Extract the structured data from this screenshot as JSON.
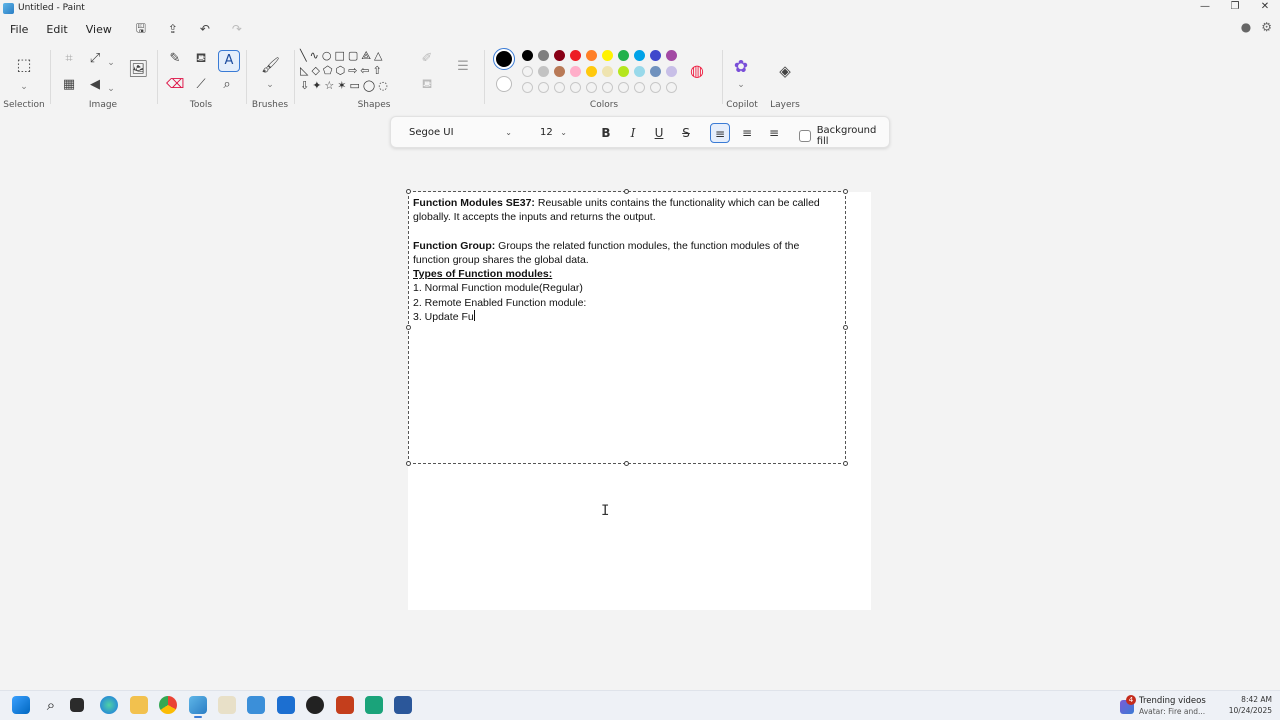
{
  "window": {
    "title": "Untitled - Paint",
    "minimize": "—",
    "maximize": "❐",
    "close": "✕"
  },
  "menu": {
    "file": "File",
    "edit": "Edit",
    "view": "View"
  },
  "ribbon": {
    "groups": {
      "selection": "Selection",
      "image": "Image",
      "tools": "Tools",
      "brushes": "Brushes",
      "shapes": "Shapes",
      "colors": "Colors",
      "copilot": "Copilot",
      "layers": "Layers"
    },
    "current_colors": {
      "primary": "#000000",
      "secondary": "#ffffff"
    },
    "palette_row1": [
      "#000000",
      "#7f7f7f",
      "#880015",
      "#ed1c24",
      "#ff7f27",
      "#fff200",
      "#22b14c",
      "#00a2e8",
      "#3f48cc",
      "#a349a4"
    ],
    "palette_row2": [
      "#ffffff",
      "#c3c3c3",
      "#b97a57",
      "#ffaec9",
      "#ffc90e",
      "#efe4b0",
      "#b5e61d",
      "#99d9ea",
      "#7092be",
      "#c8bfe7"
    ],
    "palette_row3_empty": 10
  },
  "text_toolbar": {
    "font": "Segoe UI",
    "size": "12",
    "bold": "B",
    "italic": "I",
    "underline": "U",
    "strike": "S",
    "align_left": "≡",
    "align_center": "≡",
    "align_right": "≡",
    "background_fill": "Background fill"
  },
  "document": {
    "p1_bold": "Function Modules SE37:",
    "p1_rest": " Reusable units contains the functionality which can be called globally. It accepts the inputs and returns the output.",
    "p2_bold": "Function Group:",
    "p2_rest": "  Groups the related function modules, the function modules of the function group shares the global data.",
    "types_heading": "Types of Function modules:",
    "item1": "1. Normal Function module(Regular)",
    "item2": "2. Remote Enabled Function module:",
    "item3": "3. Update Fu"
  },
  "taskbar": {
    "news_badge": "4",
    "news_title": "Trending videos",
    "news_sub": "Avatar: Fire and...",
    "time": "8:42 AM",
    "date": "10/24/2025"
  }
}
